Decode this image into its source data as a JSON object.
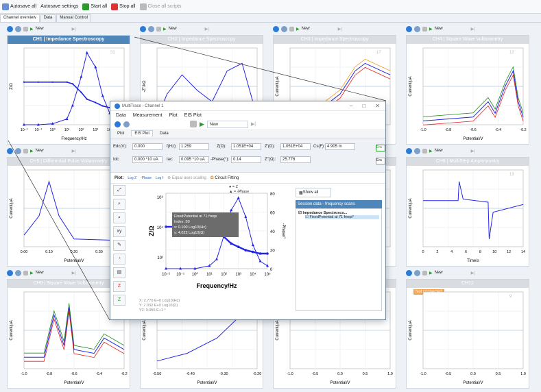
{
  "toolbar": {
    "autosave_all": "Autosave all",
    "autosave_settings": "Autosave settings",
    "start_all": "Start all",
    "stop_all": "Stop all",
    "close_all": "Close all scripts"
  },
  "tabs": [
    "Channel overview",
    "Data",
    "Manual Control"
  ],
  "channel_toolbar": {
    "method": "New"
  },
  "channels": [
    {
      "title": "CH1 | Impedance Spectroscopy",
      "num": "31",
      "xlabel": "Frequency/Hz",
      "ylabel": "Z/Ω",
      "y2label": "-Phase/°"
    },
    {
      "title": "CH2 | Impedance Spectroscopy",
      "num": "",
      "xlabel": "",
      "ylabel": "-Z''/kΩ"
    },
    {
      "title": "CH3 | Impedance Spectroscopy",
      "num": "17",
      "xlabel": "",
      "ylabel": "Current/µA"
    },
    {
      "title": "CH4 | Square Wave Voltammetry",
      "num": "12",
      "xlabel": "Potential/V",
      "ylabel": "Current/µA"
    },
    {
      "title": "CH5 | Differential Pulse Voltammetry",
      "num": "12",
      "xlabel": "Potential/V",
      "ylabel": "Current/µA"
    },
    {
      "title": "",
      "num": "",
      "xlabel": "",
      "ylabel": ""
    },
    {
      "title": "",
      "num": "",
      "xlabel": "",
      "ylabel": ""
    },
    {
      "title": "CH8 | MultiStep Amperometry",
      "num": "13",
      "xlabel": "Time/s",
      "ylabel": "Current/µA"
    },
    {
      "title": "CH9 | Square Wave Voltammetry",
      "num": "",
      "xlabel": "Potential/V",
      "ylabel": "Current/µA"
    },
    {
      "title": "",
      "num": "",
      "xlabel": "Potential/V",
      "ylabel": "Current/µA"
    },
    {
      "title": "",
      "num": "",
      "xlabel": "Potential/V",
      "ylabel": "Current/µA"
    },
    {
      "title": "CH12",
      "num": "9",
      "xlabel": "Potential/V",
      "ylabel": "Current/µA",
      "badge": "Not connected"
    }
  ],
  "dialog": {
    "title": "MultiTrace - Channel 1",
    "menu": [
      "Data",
      "Measurement",
      "Plot",
      "EIS Plot"
    ],
    "method": "New",
    "tabs": [
      "Plot",
      "EIS Plot",
      "Data"
    ],
    "values": [
      {
        "label": "Edc(V):",
        "value": "0.000"
      },
      {
        "label": "f(Hz):",
        "value": "1.259"
      },
      {
        "label": "Z(Ω):",
        "value": "1.051E+04"
      },
      {
        "label": "Z'(Ω):",
        "value": "1.051E+04"
      },
      {
        "label": "Cs(F):",
        "value": "4.905 m"
      },
      {
        "label": "Idc:",
        "value": "0.000 *10 uA"
      },
      {
        "label": "Iac:",
        "value": "0.095 *10 uA"
      },
      {
        "label": "-Phase(°):",
        "value": "0.14"
      },
      {
        "label": "Z''(Ω):",
        "value": "25.776"
      }
    ],
    "plot_label": "Plot:",
    "plot_opts": [
      "Log Z",
      "-Phase",
      "Log f"
    ],
    "equal_axes": "Equal axes scaling",
    "circuit": "Circuit Fitting",
    "legend": [
      "= Z",
      "= -Phase"
    ],
    "tooltip": [
      "FixedPotential at 71 freqs",
      "Index: 50",
      "x: 0.100 Log10(Hz)",
      "y: 4.022 Log10(Ω)"
    ],
    "xlabel": "Frequency/Hz",
    "ylabel": "Z/Ω",
    "y2label": "-Phase/°",
    "curve_num": "37",
    "coords": [
      "X: 2.770 E+0 Log10(Hz)",
      "Y: 7.032 E+0 Log10(Ω)",
      "Y2: 9.955 E+1 °"
    ],
    "show_all": "Show all",
    "session_header": "Session data - frequency scans",
    "tree": [
      "Impedance Spectrosco...",
      "FixedPotential at 71 freqs*"
    ],
    "side_btn": "Era"
  },
  "colors": {
    "blue": "#2424e6",
    "accent": "#4f86b9",
    "orange": "#f0a020",
    "green": "#1a8a1a",
    "red": "#e62020"
  },
  "chart_data": [
    {
      "type": "line",
      "title": "CH1 | Impedance Spectroscopy",
      "x": [
        -2,
        -1,
        0,
        1,
        1.4,
        2,
        2.4,
        3,
        3.5,
        4,
        4.5,
        5
      ],
      "series": [
        {
          "name": "Z",
          "values": [
            4,
            4,
            4,
            4,
            3.9,
            3.4,
            3,
            2.8,
            2.6,
            2.5,
            2.4,
            2.4
          ]
        },
        {
          "name": "-Phase",
          "values": [
            0,
            0,
            1,
            6,
            20,
            50,
            75,
            60,
            30,
            12,
            4,
            2
          ]
        }
      ],
      "xlabel": "Frequency/Hz",
      "ylabel": "Z/Ω"
    },
    {
      "type": "line",
      "title": "EIS Plot",
      "x": [
        -2,
        -1,
        0,
        1,
        1.5,
        2,
        2.5,
        3,
        3.5,
        4,
        4.5,
        5
      ],
      "series": [
        {
          "name": "Z",
          "values": [
            4,
            4,
            4,
            4,
            3.9,
            3.4,
            3,
            2.8,
            2.6,
            2.5,
            2.4,
            2.4
          ]
        },
        {
          "name": "-Phase",
          "values": [
            0,
            0,
            0,
            3,
            10,
            35,
            62,
            75,
            55,
            25,
            8,
            3
          ]
        }
      ],
      "xlabel": "Frequency/Hz",
      "ylabel": "Z/Ω",
      "y2label": "-Phase/°"
    }
  ]
}
